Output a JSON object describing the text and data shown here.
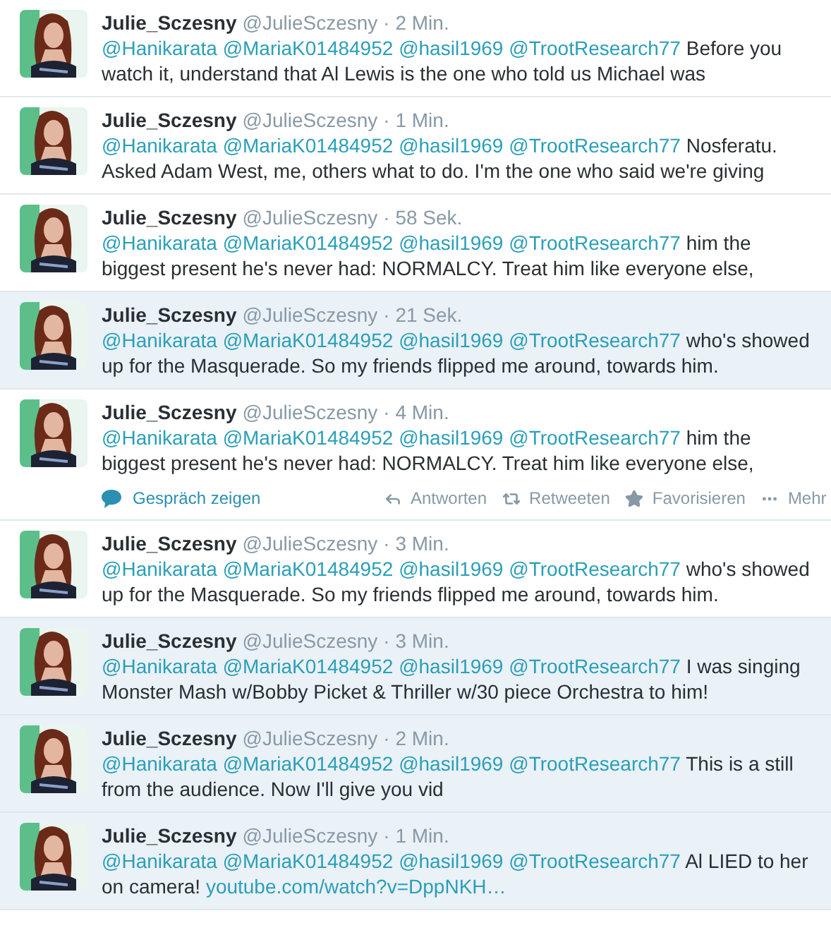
{
  "tweets": [
    {
      "name": "Julie_Sczesny",
      "handle": "@JulieSczesny",
      "time": "· 2 Min.",
      "mentions": [
        "@Hanikarata",
        "@MariaK01484952",
        "@hasil1969",
        "@TrootResearch77"
      ],
      "text": "Before you watch it, understand that Al Lewis is the one who told us Michael was",
      "highlighted": false
    },
    {
      "name": "Julie_Sczesny",
      "handle": "@JulieSczesny",
      "time": "· 1 Min.",
      "mentions": [
        "@Hanikarata",
        "@MariaK01484952",
        "@hasil1969",
        "@TrootResearch77"
      ],
      "text": "Nosferatu. Asked Adam West, me, others what to do. I'm the one who said we're giving",
      "highlighted": false
    },
    {
      "name": "Julie_Sczesny",
      "handle": "@JulieSczesny",
      "time": "· 58 Sek.",
      "mentions": [
        "@Hanikarata",
        "@MariaK01484952",
        "@hasil1969",
        "@TrootResearch77"
      ],
      "text": "him the biggest present he's never had: NORMALCY. Treat him like everyone else,",
      "highlighted": false
    },
    {
      "name": "Julie_Sczesny",
      "handle": "@JulieSczesny",
      "time": "· 21 Sek.",
      "mentions": [
        "@Hanikarata",
        "@MariaK01484952",
        "@hasil1969",
        "@TrootResearch77"
      ],
      "text": "who's showed up for the Masquerade. So my friends flipped me around, towards him.",
      "highlighted": true
    },
    {
      "name": "Julie_Sczesny",
      "handle": "@JulieSczesny",
      "time": "· 4 Min.",
      "mentions": [
        "@Hanikarata",
        "@MariaK01484952",
        "@hasil1969",
        "@TrootResearch77"
      ],
      "text": "him the biggest present he's never had: NORMALCY. Treat him like everyone else,",
      "highlighted": false,
      "conversation": "Gespräch zeigen",
      "actions": [
        "Antworten",
        "Retweeten",
        "Favorisieren",
        "Mehr"
      ]
    },
    {
      "name": "Julie_Sczesny",
      "handle": "@JulieSczesny",
      "time": "· 3 Min.",
      "mentions": [
        "@Hanikarata",
        "@MariaK01484952",
        "@hasil1969",
        "@TrootResearch77"
      ],
      "text": "who's showed up for the Masquerade. So my friends flipped me around, towards him.",
      "highlighted": false
    },
    {
      "name": "Julie_Sczesny",
      "handle": "@JulieSczesny",
      "time": "· 3 Min.",
      "mentions": [
        "@Hanikarata",
        "@MariaK01484952",
        "@hasil1969",
        "@TrootResearch77"
      ],
      "text": "I was singing Monster Mash w/Bobby Picket & Thriller w/30 piece Orchestra to him!",
      "highlighted": true
    },
    {
      "name": "Julie_Sczesny",
      "handle": "@JulieSczesny",
      "time": "· 2 Min.",
      "mentions": [
        "@Hanikarata",
        "@MariaK01484952",
        "@hasil1969",
        "@TrootResearch77"
      ],
      "text": "This is a still from the audience. Now I'll give you vid",
      "highlighted": true
    },
    {
      "name": "Julie_Sczesny",
      "handle": "@JulieSczesny",
      "time": "· 1 Min.",
      "mentions": [
        "@Hanikarata",
        "@MariaK01484952",
        "@hasil1969",
        "@TrootResearch77"
      ],
      "text": "Al LIED to her on camera!",
      "link": "youtube.com/watch?v=DppNKH…",
      "highlighted": true
    }
  ]
}
